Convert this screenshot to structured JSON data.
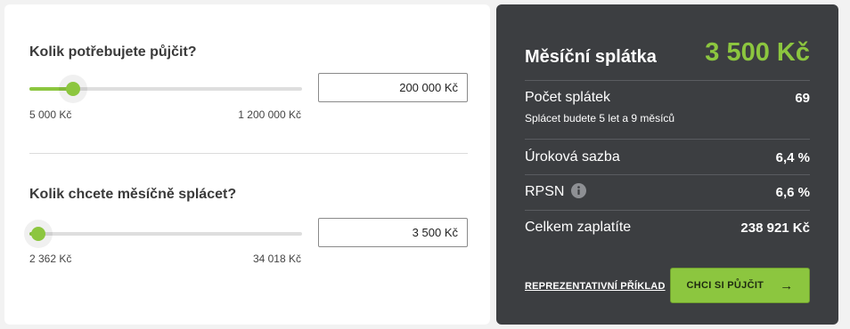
{
  "loan": {
    "amount_title": "Kolik potřebujete půjčit?",
    "amount_value": "200 000 Kč",
    "amount_min": "5 000 Kč",
    "amount_max": "1 200 000 Kč",
    "amount_slider_fraction": 0.16,
    "payment_title": "Kolik chcete měsíčně splácet?",
    "payment_value": "3 500 Kč",
    "payment_min": "2 362 Kč",
    "payment_max": "34 018 Kč",
    "payment_slider_fraction": 0.034
  },
  "summary": {
    "title": "Měsíční splátka",
    "monthly_payment": "3 500 Kč",
    "installments_label": "Počet splátek",
    "installments_value": "69",
    "installments_note": "Splácet budete 5 let a 9 měsíců",
    "interest_label": "Úroková sazba",
    "interest_value": "6,4 %",
    "rpsn_label": "RPSN",
    "rpsn_value": "6,6 %",
    "total_label": "Celkem zaplatíte",
    "total_value": "238 921 Kč",
    "example_link": "REPREZENTATIVNÍ PŘÍKLAD",
    "cta_label": "CHCI SI PŮJČIT",
    "cta_icon": "arrow-right-icon"
  },
  "colors": {
    "accent": "#8cc63f",
    "panel_dark": "#3c3e41",
    "track": "#dedede"
  }
}
